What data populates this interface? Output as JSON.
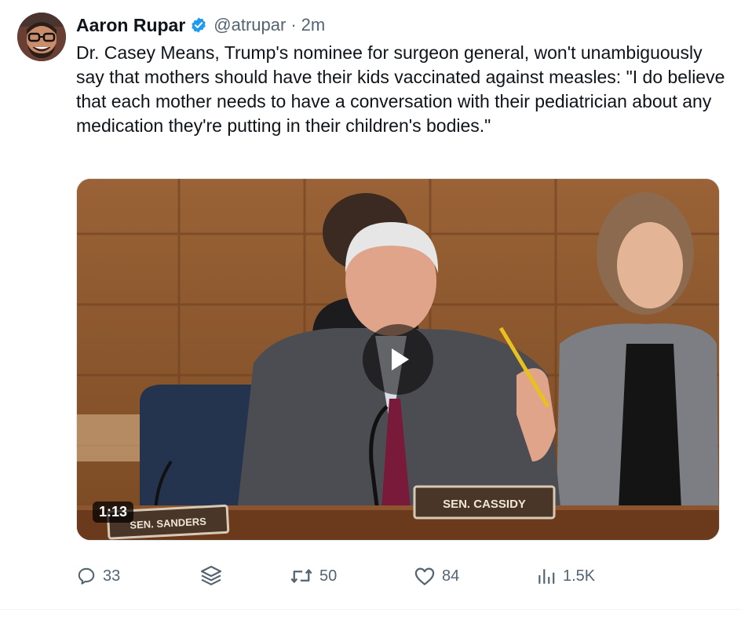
{
  "author": {
    "name": "Aaron Rupar",
    "handle": "@atrupar",
    "separator": "·",
    "time": "2m",
    "verified_icon": "verified-badge-icon",
    "accent": "#1d9bf0"
  },
  "tweet": {
    "text": "Dr. Casey Means, Trump's nominee for surgeon general, won't unambiguously say that mothers should have their kids vaccinated against measles: \"I do believe that each mother needs to have a conversation with their pediatrician about any medication they're putting in their children's bodies.\""
  },
  "video": {
    "duration": "1:13",
    "nameplate_left": "SEN. SANDERS",
    "nameplate_center": "SEN. CASSIDY",
    "play_icon": "play-icon"
  },
  "actions": {
    "replies": "33",
    "retweets": "50",
    "likes": "84",
    "views": "1.5K",
    "icons": [
      "reply-icon",
      "grok-icon",
      "retweet-icon",
      "like-icon",
      "views-icon"
    ]
  }
}
